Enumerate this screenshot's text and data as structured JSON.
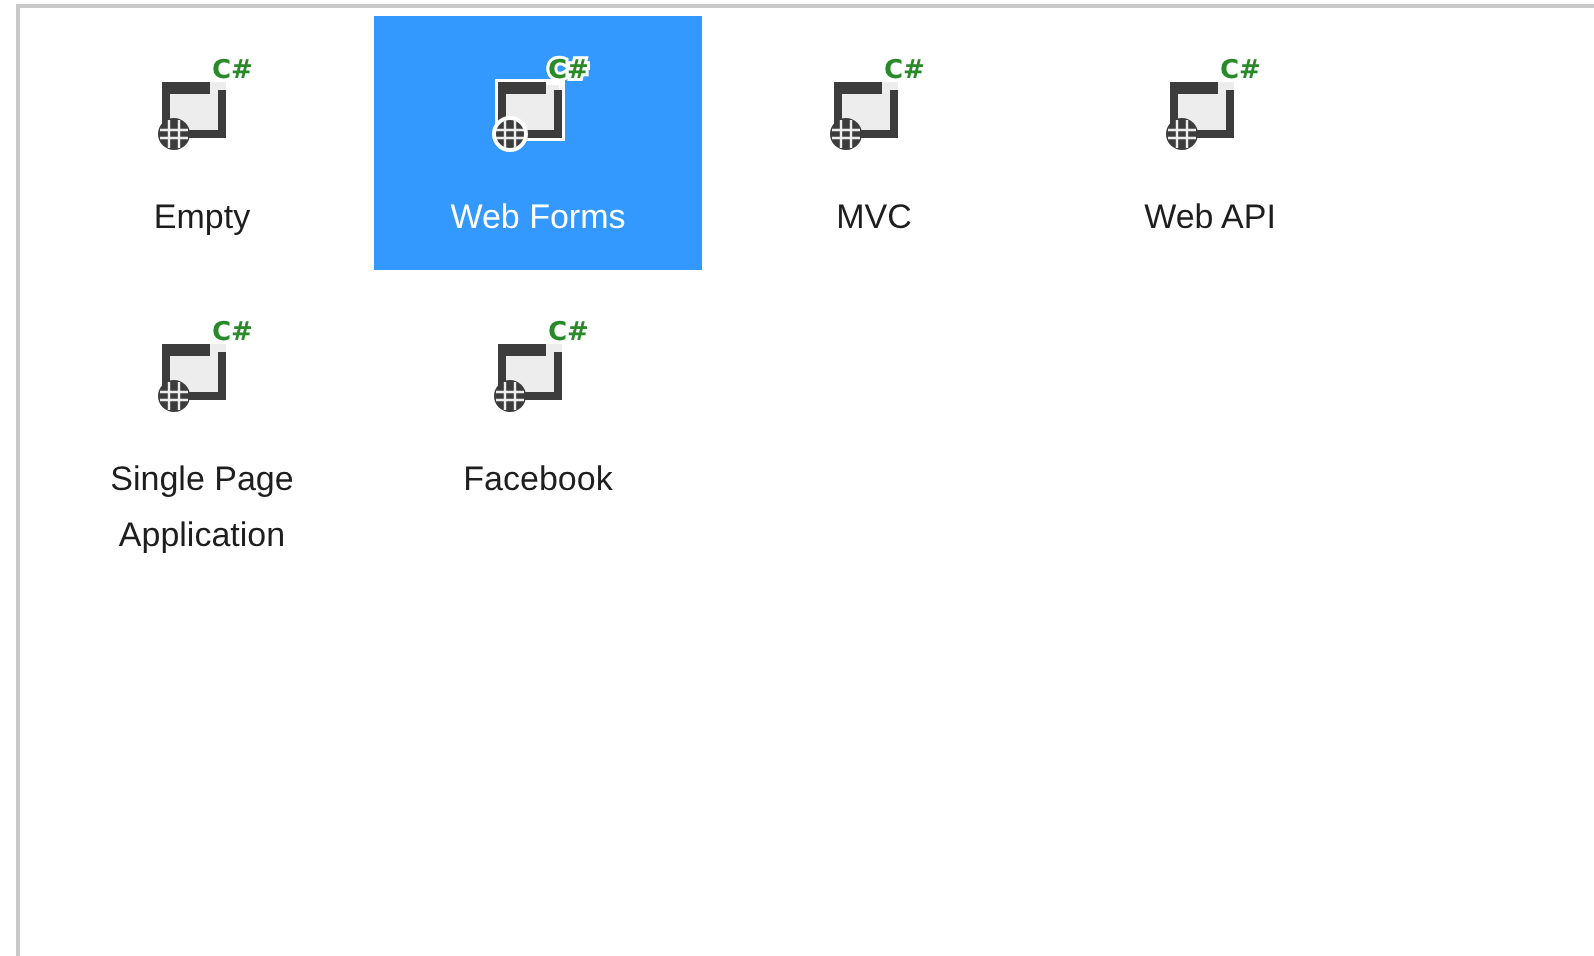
{
  "templates": [
    {
      "label": "Empty",
      "badge": "C#",
      "selected": false
    },
    {
      "label": "Web Forms",
      "badge": "C#",
      "selected": true
    },
    {
      "label": "MVC",
      "badge": "C#",
      "selected": false
    },
    {
      "label": "Web API",
      "badge": "C#",
      "selected": false
    },
    {
      "label": "Single Page Application",
      "badge": "C#",
      "selected": false
    },
    {
      "label": "Facebook",
      "badge": "C#",
      "selected": false
    }
  ]
}
